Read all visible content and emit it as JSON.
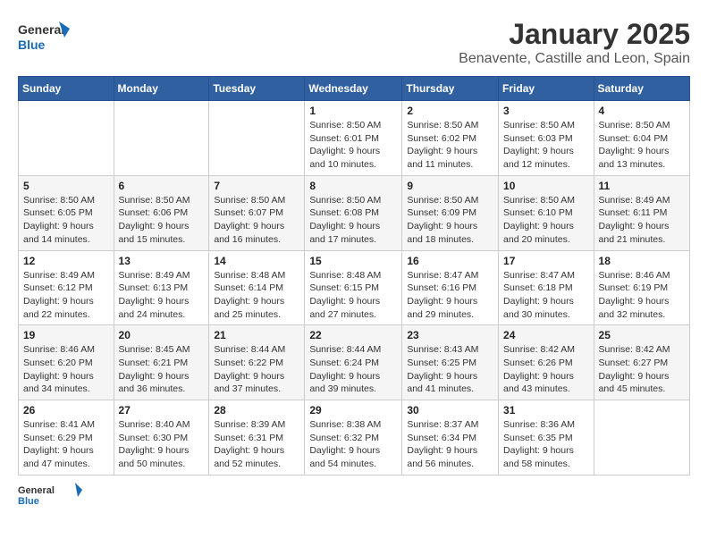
{
  "logo": {
    "general": "General",
    "blue": "Blue"
  },
  "title": "January 2025",
  "subtitle": "Benavente, Castille and Leon, Spain",
  "weekdays": [
    "Sunday",
    "Monday",
    "Tuesday",
    "Wednesday",
    "Thursday",
    "Friday",
    "Saturday"
  ],
  "weeks": [
    [
      {
        "day": "",
        "info": ""
      },
      {
        "day": "",
        "info": ""
      },
      {
        "day": "",
        "info": ""
      },
      {
        "day": "1",
        "info": "Sunrise: 8:50 AM\nSunset: 6:01 PM\nDaylight: 9 hours\nand 10 minutes."
      },
      {
        "day": "2",
        "info": "Sunrise: 8:50 AM\nSunset: 6:02 PM\nDaylight: 9 hours\nand 11 minutes."
      },
      {
        "day": "3",
        "info": "Sunrise: 8:50 AM\nSunset: 6:03 PM\nDaylight: 9 hours\nand 12 minutes."
      },
      {
        "day": "4",
        "info": "Sunrise: 8:50 AM\nSunset: 6:04 PM\nDaylight: 9 hours\nand 13 minutes."
      }
    ],
    [
      {
        "day": "5",
        "info": "Sunrise: 8:50 AM\nSunset: 6:05 PM\nDaylight: 9 hours\nand 14 minutes."
      },
      {
        "day": "6",
        "info": "Sunrise: 8:50 AM\nSunset: 6:06 PM\nDaylight: 9 hours\nand 15 minutes."
      },
      {
        "day": "7",
        "info": "Sunrise: 8:50 AM\nSunset: 6:07 PM\nDaylight: 9 hours\nand 16 minutes."
      },
      {
        "day": "8",
        "info": "Sunrise: 8:50 AM\nSunset: 6:08 PM\nDaylight: 9 hours\nand 17 minutes."
      },
      {
        "day": "9",
        "info": "Sunrise: 8:50 AM\nSunset: 6:09 PM\nDaylight: 9 hours\nand 18 minutes."
      },
      {
        "day": "10",
        "info": "Sunrise: 8:50 AM\nSunset: 6:10 PM\nDaylight: 9 hours\nand 20 minutes."
      },
      {
        "day": "11",
        "info": "Sunrise: 8:49 AM\nSunset: 6:11 PM\nDaylight: 9 hours\nand 21 minutes."
      }
    ],
    [
      {
        "day": "12",
        "info": "Sunrise: 8:49 AM\nSunset: 6:12 PM\nDaylight: 9 hours\nand 22 minutes."
      },
      {
        "day": "13",
        "info": "Sunrise: 8:49 AM\nSunset: 6:13 PM\nDaylight: 9 hours\nand 24 minutes."
      },
      {
        "day": "14",
        "info": "Sunrise: 8:48 AM\nSunset: 6:14 PM\nDaylight: 9 hours\nand 25 minutes."
      },
      {
        "day": "15",
        "info": "Sunrise: 8:48 AM\nSunset: 6:15 PM\nDaylight: 9 hours\nand 27 minutes."
      },
      {
        "day": "16",
        "info": "Sunrise: 8:47 AM\nSunset: 6:16 PM\nDaylight: 9 hours\nand 29 minutes."
      },
      {
        "day": "17",
        "info": "Sunrise: 8:47 AM\nSunset: 6:18 PM\nDaylight: 9 hours\nand 30 minutes."
      },
      {
        "day": "18",
        "info": "Sunrise: 8:46 AM\nSunset: 6:19 PM\nDaylight: 9 hours\nand 32 minutes."
      }
    ],
    [
      {
        "day": "19",
        "info": "Sunrise: 8:46 AM\nSunset: 6:20 PM\nDaylight: 9 hours\nand 34 minutes."
      },
      {
        "day": "20",
        "info": "Sunrise: 8:45 AM\nSunset: 6:21 PM\nDaylight: 9 hours\nand 36 minutes."
      },
      {
        "day": "21",
        "info": "Sunrise: 8:44 AM\nSunset: 6:22 PM\nDaylight: 9 hours\nand 37 minutes."
      },
      {
        "day": "22",
        "info": "Sunrise: 8:44 AM\nSunset: 6:24 PM\nDaylight: 9 hours\nand 39 minutes."
      },
      {
        "day": "23",
        "info": "Sunrise: 8:43 AM\nSunset: 6:25 PM\nDaylight: 9 hours\nand 41 minutes."
      },
      {
        "day": "24",
        "info": "Sunrise: 8:42 AM\nSunset: 6:26 PM\nDaylight: 9 hours\nand 43 minutes."
      },
      {
        "day": "25",
        "info": "Sunrise: 8:42 AM\nSunset: 6:27 PM\nDaylight: 9 hours\nand 45 minutes."
      }
    ],
    [
      {
        "day": "26",
        "info": "Sunrise: 8:41 AM\nSunset: 6:29 PM\nDaylight: 9 hours\nand 47 minutes."
      },
      {
        "day": "27",
        "info": "Sunrise: 8:40 AM\nSunset: 6:30 PM\nDaylight: 9 hours\nand 50 minutes."
      },
      {
        "day": "28",
        "info": "Sunrise: 8:39 AM\nSunset: 6:31 PM\nDaylight: 9 hours\nand 52 minutes."
      },
      {
        "day": "29",
        "info": "Sunrise: 8:38 AM\nSunset: 6:32 PM\nDaylight: 9 hours\nand 54 minutes."
      },
      {
        "day": "30",
        "info": "Sunrise: 8:37 AM\nSunset: 6:34 PM\nDaylight: 9 hours\nand 56 minutes."
      },
      {
        "day": "31",
        "info": "Sunrise: 8:36 AM\nSunset: 6:35 PM\nDaylight: 9 hours\nand 58 minutes."
      },
      {
        "day": "",
        "info": ""
      }
    ]
  ]
}
